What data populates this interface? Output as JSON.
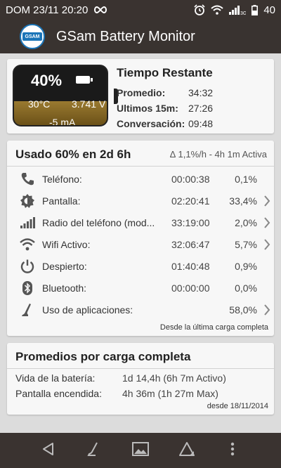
{
  "status_bar": {
    "datetime": "DOM 23/11 20:20",
    "network": "3G",
    "battery_level": "40"
  },
  "app_bar": {
    "title": "GSam Battery Monitor",
    "logo_text": "GSAM"
  },
  "battery_card": {
    "percent": "40%",
    "temperature": "30°C",
    "voltage": "3.741 V",
    "current": "-5 mA",
    "fill_fraction": 0.4,
    "remaining": {
      "title": "Tiempo Restante",
      "rows": [
        {
          "label": "Promedio:",
          "value": "34:32"
        },
        {
          "label": "Ultimos 15m:",
          "value": "27:26"
        },
        {
          "label": "Conversación:",
          "value": "09:48"
        }
      ]
    }
  },
  "usage_card": {
    "title": "Usado 60% en 2d 6h",
    "rate": "∆ 1,1%/h - 4h 1m Activa",
    "rows": [
      {
        "icon": "phone-icon",
        "name": "Teléfono:",
        "time": "00:00:38",
        "percent": "0,1%",
        "chevron": false
      },
      {
        "icon": "screen-brightness-icon",
        "name": "Pantalla:",
        "time": "02:20:41",
        "percent": "33,4%",
        "chevron": true
      },
      {
        "icon": "signal-bars-icon",
        "name": "Radio del teléfono (mod...",
        "time": "33:19:00",
        "percent": "2,0%",
        "chevron": true
      },
      {
        "icon": "wifi-icon",
        "name": "Wifi Activo:",
        "time": "32:06:47",
        "percent": "5,7%",
        "chevron": true
      },
      {
        "icon": "power-icon",
        "name": "Despierto:",
        "time": "01:40:48",
        "percent": "0,9%",
        "chevron": false
      },
      {
        "icon": "bluetooth-icon",
        "name": "Bluetooth:",
        "time": "00:00:00",
        "percent": "0,0%",
        "chevron": false
      },
      {
        "icon": "app-usage-icon",
        "name": "Uso de aplicaciones:",
        "time": "",
        "percent": "58,0%",
        "chevron": true
      }
    ],
    "footnote": "Desde la última carga completa"
  },
  "averages_card": {
    "title": "Promedios por carga completa",
    "rows": [
      {
        "label": "Vida de la batería:",
        "value": "1d 14,4h (6h 7m Activo)"
      },
      {
        "label": "Pantalla encendida:",
        "value": "4h 36m (1h 27m Max)"
      }
    ],
    "footnote": "desde 18/11/2014"
  },
  "nav_bar": {
    "items": [
      {
        "icon": "back-icon"
      },
      {
        "icon": "app-usage-icon"
      },
      {
        "icon": "picture-icon"
      },
      {
        "icon": "warning-triangle-icon"
      },
      {
        "icon": "more-vert-icon"
      }
    ]
  },
  "colors": {
    "status_bar_bg": "#3a3330",
    "app_bar_bg": "#393330",
    "card_bg": "#f7f7f7",
    "page_bg": "#dcdcdc",
    "battery_fill": "#8a6a25"
  }
}
